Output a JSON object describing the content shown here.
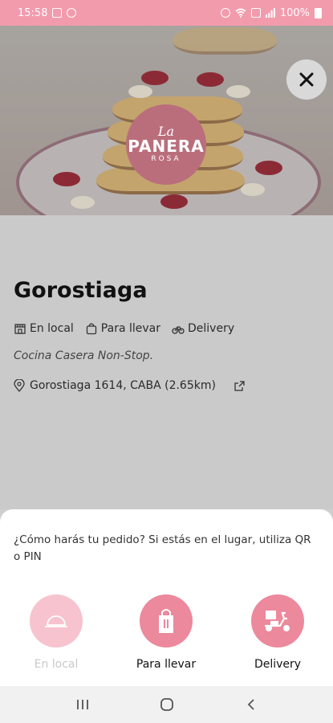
{
  "status_bar": {
    "time": "15:58",
    "battery": "100%",
    "color": "#f29bac",
    "left_icons": [
      "gallery-icon",
      "notification-icon"
    ],
    "right_icons": [
      "alarm-icon",
      "wifi-icon",
      "data-icon",
      "signal-icon",
      "battery-icon"
    ]
  },
  "hero": {
    "logo_script": "La",
    "logo_main": "PANERA",
    "logo_sub": "ROSA",
    "close_icon": "close-icon"
  },
  "restaurant": {
    "name": "Gorostiaga",
    "modes": [
      {
        "label": "En local",
        "icon": "store-icon"
      },
      {
        "label": "Para llevar",
        "icon": "bag-icon"
      },
      {
        "label": "Delivery",
        "icon": "bike-icon"
      }
    ],
    "tagline": "Cocina Casera Non-Stop.",
    "address": "Gorostiaga 1614, CABA (2.65km)",
    "address_icon": "location-pin-icon",
    "external_icon": "external-link-icon"
  },
  "sheet": {
    "prompt": "¿Cómo harás tu pedido? Si estás en el lugar, utiliza QR o PIN",
    "accent": "#ec899c",
    "options": [
      {
        "label": "En local",
        "icon": "cloche-icon",
        "enabled": false
      },
      {
        "label": "Para llevar",
        "icon": "takeaway-bag-icon",
        "enabled": true
      },
      {
        "label": "Delivery",
        "icon": "scooter-icon",
        "enabled": true
      }
    ]
  },
  "nav_bar": {
    "buttons": [
      "recent-apps-icon",
      "home-icon",
      "back-icon"
    ]
  }
}
